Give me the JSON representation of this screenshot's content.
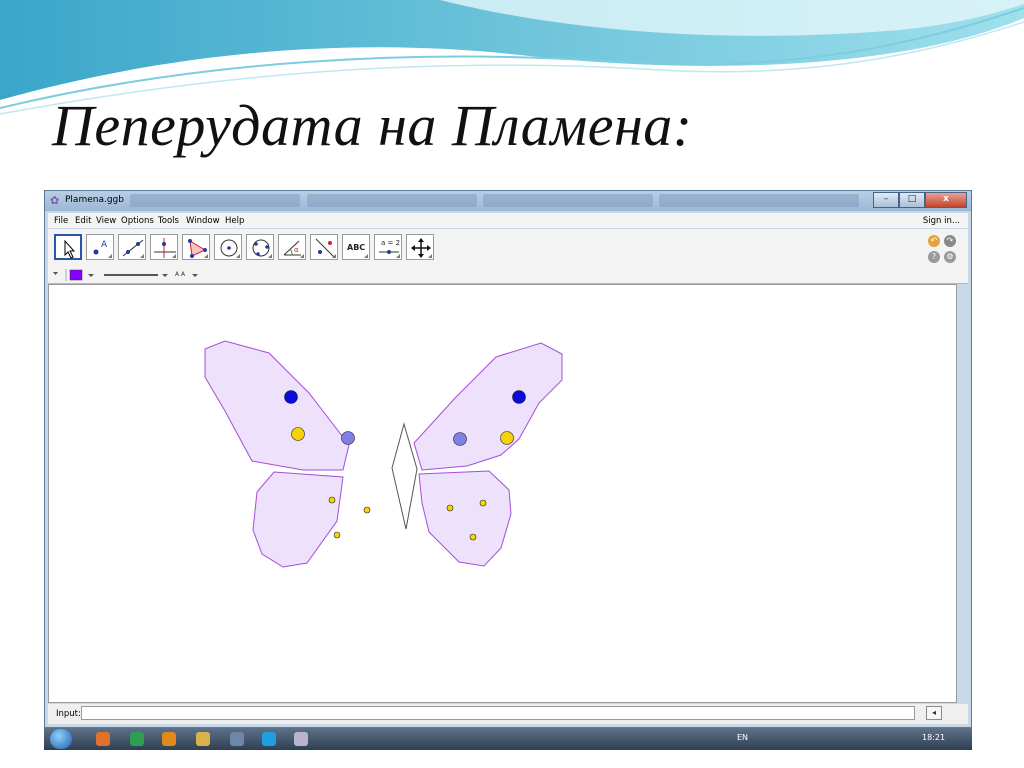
{
  "slide": {
    "title": "Пеперудата на Пламена:"
  },
  "window": {
    "title": "Plamena.ggb",
    "minimize": "–",
    "maximize": "□",
    "close": "x"
  },
  "menu": {
    "items": [
      "File",
      "Edit",
      "View",
      "Options",
      "Tools",
      "Window",
      "Help"
    ],
    "sign_in": "Sign in..."
  },
  "toolbar": {
    "text_tool_label": "ABC",
    "slider_tool_label": "a = 2"
  },
  "stylebar": {
    "font_size_label": "A A"
  },
  "input": {
    "label": "Input:",
    "value": ""
  },
  "taskbar": {
    "language": "EN",
    "time": "18:21"
  },
  "colors": {
    "wing_fill": "#ede1fb",
    "wing_stroke": "#a24fd9",
    "blue_dot": "#0b0be0",
    "lavender_dot": "#7f7fe6",
    "yellow_dot": "#f7d20a",
    "style_color": "#8800ff"
  },
  "icons": [
    "app-icon",
    "move-arrow-icon",
    "point-icon",
    "line-icon",
    "perpendicular-icon",
    "polygon-icon",
    "circle-center-icon",
    "circle-three-points-icon",
    "angle-icon",
    "reflect-icon",
    "text-icon",
    "slider-icon",
    "move-view-icon",
    "undo-icon",
    "redo-icon",
    "help-icon",
    "settings-icon",
    "keyboard-icon",
    "start-icon"
  ]
}
